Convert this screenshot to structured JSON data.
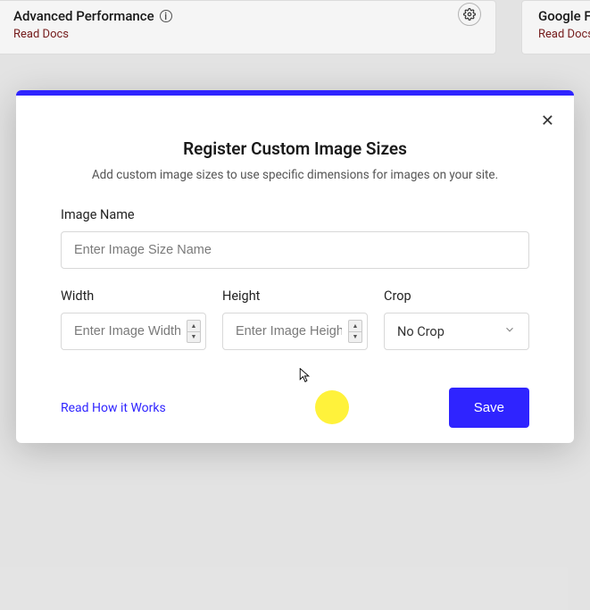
{
  "background": {
    "cards": [
      {
        "title": "Advanced Performance",
        "link": "Read Docs"
      },
      {
        "title": "Google Fon",
        "link": "Read Docs"
      }
    ]
  },
  "modal": {
    "title": "Register Custom Image Sizes",
    "subtitle": "Add custom image sizes to use specific dimensions for images on your site.",
    "close_aria": "Close",
    "fields": {
      "name": {
        "label": "Image Name",
        "placeholder": "Enter Image Size Name",
        "value": ""
      },
      "width": {
        "label": "Width",
        "placeholder": "Enter Image Width",
        "value": ""
      },
      "height": {
        "label": "Height",
        "placeholder": "Enter Image Height",
        "value": ""
      },
      "crop": {
        "label": "Crop",
        "selected": "No Crop"
      }
    },
    "help_link": "Read How it Works",
    "save_label": "Save"
  }
}
